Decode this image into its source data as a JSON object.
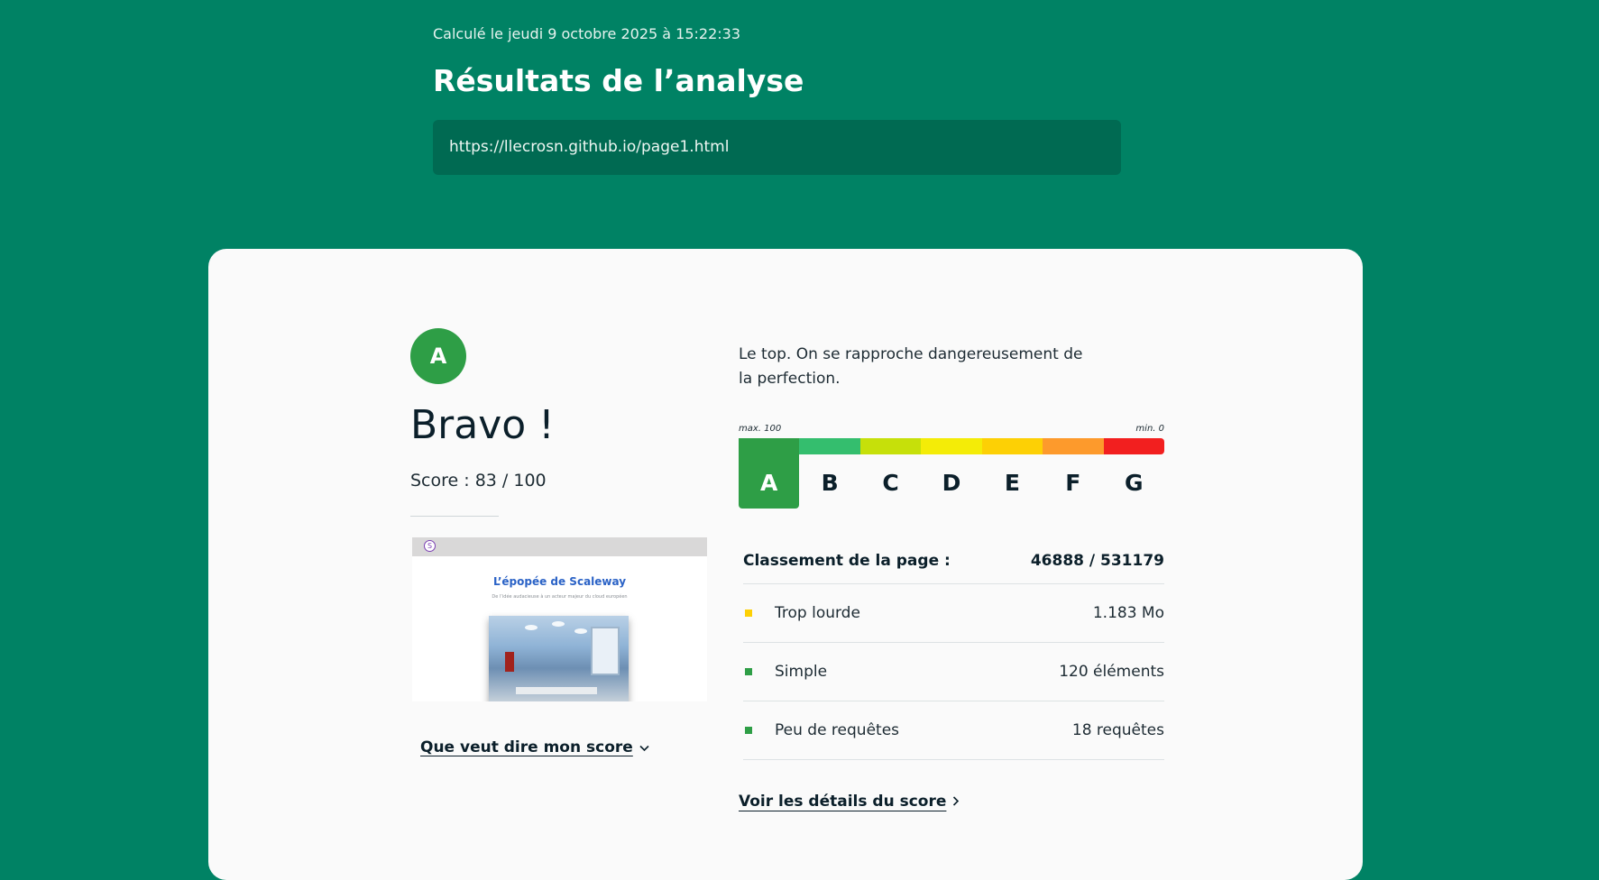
{
  "header": {
    "calculated": "Calculé le jeudi 9 octobre 2025 à 15:22:33",
    "title": "Résultats de l’analyse",
    "url": "https://llecrosn.github.io/page1.html"
  },
  "result": {
    "grade": "A",
    "headline": "Bravo !",
    "score_text": "Score : 83 / 100",
    "description": "Le top. On se rapproche dangereusement de la perfection.",
    "thumbnail": {
      "title": "L’épopée de Scaleway",
      "subtitle": "De l’idée audacieuse à un acteur majeur du cloud européen"
    },
    "explain_link": "Que veut dire mon score",
    "details_link": "Voir les détails du score"
  },
  "scale": {
    "max_label": "max. 100",
    "min_label": "min. 0",
    "grades": [
      {
        "letter": "A",
        "color": "#2e9e46"
      },
      {
        "letter": "B",
        "color": "#34be6e"
      },
      {
        "letter": "C",
        "color": "#c6e00a"
      },
      {
        "letter": "D",
        "color": "#f4ec07"
      },
      {
        "letter": "E",
        "color": "#fdd005"
      },
      {
        "letter": "F",
        "color": "#fd9a2c"
      },
      {
        "letter": "G",
        "color": "#f21f1f"
      }
    ],
    "active_grade": "A"
  },
  "ranking": {
    "label": "Classement de la page :",
    "value": "46888 / 531179"
  },
  "metrics": [
    {
      "label": "Trop lourde",
      "value": "1.183 Mo",
      "color": "#fdd005"
    },
    {
      "label": "Simple",
      "value": "120 éléments",
      "color": "#2e9e46"
    },
    {
      "label": "Peu de requêtes",
      "value": "18 requêtes",
      "color": "#2e9e46"
    }
  ],
  "icons": {
    "chevron_down": "chevron-down-icon",
    "chevron_right": "chevron-right-icon"
  }
}
